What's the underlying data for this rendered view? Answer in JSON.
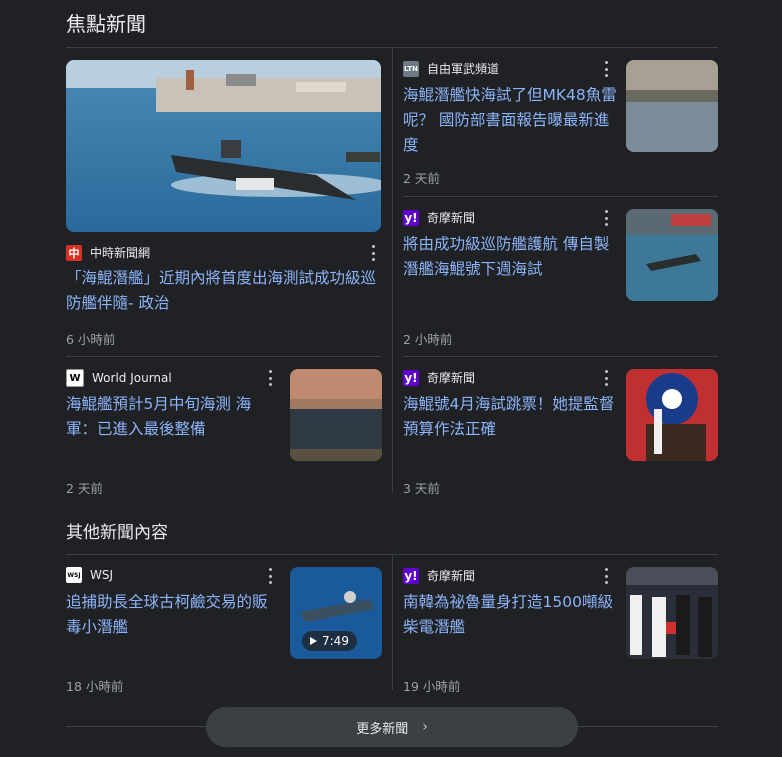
{
  "sections": {
    "top": "焦點新聞",
    "other": "其他新聞內容"
  },
  "articles": [
    {
      "source": "中時新聞網",
      "logo": "中",
      "headline": "「海鯤潛艦」近期內將首度出海測試成功級巡防艦伴隨- 政治",
      "time": "6 小時前"
    },
    {
      "source": "自由軍武頻道",
      "logo": "LTN",
      "headline": "海鯤潛艦快海試了但MK48魚雷呢？ 國防部書面報告曝最新進度",
      "time": "2 天前"
    },
    {
      "source": "奇摩新聞",
      "logo": "y!",
      "headline": "將由成功級巡防艦護航 傳自製潛艦海鯤號下週海試",
      "time": "2 小時前"
    },
    {
      "source": "World Journal",
      "logo": "W",
      "headline": "海鯤艦預計5月中旬海測 海軍：已進入最後整備",
      "time": "2 天前"
    },
    {
      "source": "奇摩新聞",
      "logo": "y!",
      "headline": "海鯤號4月海試跳票！她提監督預算作法正確",
      "time": "3 天前"
    },
    {
      "source": "WSJ",
      "logo": "WSJ",
      "headline": "追捕助長全球古柯鹼交易的販毒小潛艦",
      "time": "18 小時前",
      "duration": "7:49"
    },
    {
      "source": "奇摩新聞",
      "logo": "y!",
      "headline": "南韓為祕魯量身打造1500噸級柴電潛艦",
      "time": "19 小時前"
    }
  ],
  "more_button": "更多新聞",
  "icons": {
    "kebab": "more-vert-icon",
    "chevron": "chevron-right-icon",
    "play": "play-icon"
  }
}
